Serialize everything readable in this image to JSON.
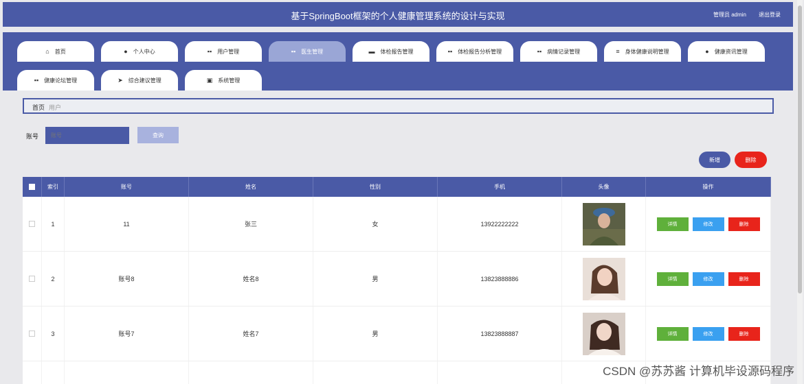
{
  "header": {
    "title": "基于SpringBoot框架的个人健康管理系统的设计与实现",
    "user_label": "管理员 admin",
    "logout_label": "退出登录"
  },
  "nav": {
    "tabs": [
      {
        "label": "首页",
        "icon": "home-icon",
        "active": false
      },
      {
        "label": "个人中心",
        "icon": "user-icon",
        "active": false
      },
      {
        "label": "用户管理",
        "icon": "grid-icon",
        "active": false
      },
      {
        "label": "医生管理",
        "icon": "grid-icon",
        "active": true
      },
      {
        "label": "体检报告管理",
        "icon": "briefcase-icon",
        "active": false
      },
      {
        "label": "体检报告分析管理",
        "icon": "grid-icon",
        "active": false
      },
      {
        "label": "病情记录管理",
        "icon": "grid-icon",
        "active": false
      },
      {
        "label": "身体健康说明管理",
        "icon": "text-icon",
        "active": false
      },
      {
        "label": "健康资讯管理",
        "icon": "user-icon",
        "active": false
      },
      {
        "label": "健康论坛管理",
        "icon": "grid-icon",
        "active": false
      },
      {
        "label": "综合建议管理",
        "icon": "send-icon",
        "active": false
      },
      {
        "label": "系统管理",
        "icon": "clipboard-icon",
        "active": false
      }
    ]
  },
  "breadcrumb": {
    "home": "首页",
    "current": "用户"
  },
  "search": {
    "label": "账号",
    "placeholder": "账号",
    "button": "查询"
  },
  "actions": {
    "add": "新增",
    "delete": "删除"
  },
  "table": {
    "columns": [
      "索引",
      "账号",
      "姓名",
      "性别",
      "手机",
      "头像",
      "操作"
    ],
    "row_actions": {
      "detail": "详情",
      "edit": "修改",
      "remove": "删除"
    },
    "rows": [
      {
        "index": "1",
        "account": "11",
        "name": "张三",
        "gender": "女",
        "phone": "13922222222",
        "avatar": "soldier"
      },
      {
        "index": "2",
        "account": "账号8",
        "name": "姓名8",
        "gender": "男",
        "phone": "13823888886",
        "avatar": "girl-1"
      },
      {
        "index": "3",
        "account": "账号7",
        "name": "姓名7",
        "gender": "男",
        "phone": "13823888887",
        "avatar": "girl-2"
      }
    ]
  },
  "watermark": "CSDN @苏苏酱 计算机毕设源码程序",
  "colors": {
    "primary": "#4a5aa6",
    "danger": "#e8241b",
    "success": "#5fb03b",
    "info": "#3aa0f0"
  }
}
